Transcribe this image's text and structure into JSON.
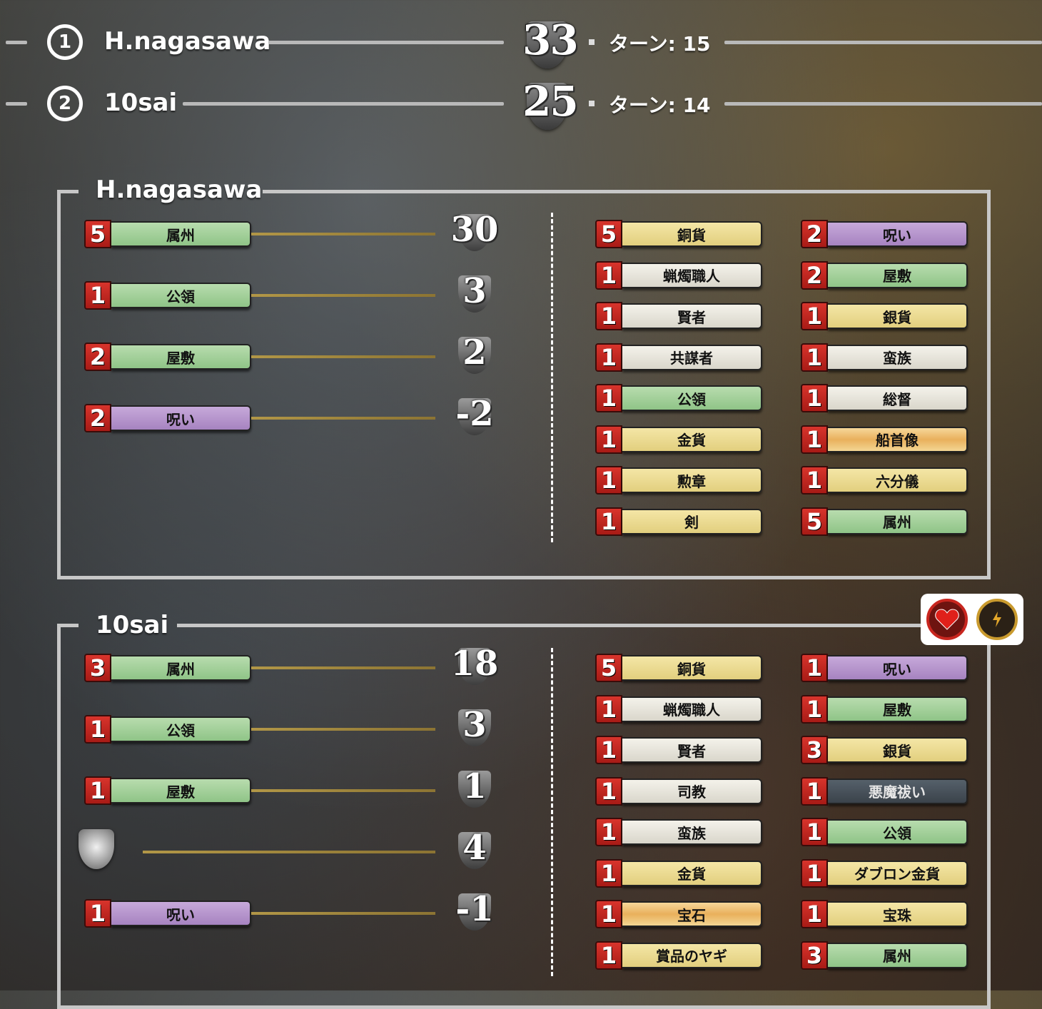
{
  "header": {
    "rows": [
      {
        "rank": "1",
        "name": "H.nagasawa",
        "score": "33",
        "turn": "ターン: 15"
      },
      {
        "rank": "2",
        "name": "10sai",
        "score": "25",
        "turn": "ターン: 14"
      }
    ]
  },
  "players": [
    {
      "title": "H.nagasawa",
      "summary": [
        {
          "count": "5",
          "label": "属州",
          "color": "green",
          "vp": "30"
        },
        {
          "count": "1",
          "label": "公領",
          "color": "green",
          "vp": "3"
        },
        {
          "count": "2",
          "label": "屋敷",
          "color": "green",
          "vp": "2"
        },
        {
          "count": "2",
          "label": "呪い",
          "color": "purple",
          "vp": "-2"
        }
      ],
      "cards_left": [
        {
          "count": "5",
          "label": "銅貨",
          "color": "yellow"
        },
        {
          "count": "1",
          "label": "蝋燭職人",
          "color": "white"
        },
        {
          "count": "1",
          "label": "賢者",
          "color": "white"
        },
        {
          "count": "1",
          "label": "共謀者",
          "color": "white"
        },
        {
          "count": "1",
          "label": "公領",
          "color": "green"
        },
        {
          "count": "1",
          "label": "金貨",
          "color": "yellow"
        },
        {
          "count": "1",
          "label": "勲章",
          "color": "yellow"
        },
        {
          "count": "1",
          "label": "剣",
          "color": "yellow"
        }
      ],
      "cards_right": [
        {
          "count": "2",
          "label": "呪い",
          "color": "purple"
        },
        {
          "count": "2",
          "label": "屋敷",
          "color": "green"
        },
        {
          "count": "1",
          "label": "銀貨",
          "color": "yellow"
        },
        {
          "count": "1",
          "label": "蛮族",
          "color": "white"
        },
        {
          "count": "1",
          "label": "総督",
          "color": "white"
        },
        {
          "count": "1",
          "label": "船首像",
          "color": "orange"
        },
        {
          "count": "1",
          "label": "六分儀",
          "color": "yellow"
        },
        {
          "count": "5",
          "label": "属州",
          "color": "green"
        }
      ]
    },
    {
      "title": "10sai",
      "summary": [
        {
          "count": "3",
          "label": "属州",
          "color": "green",
          "vp": "18"
        },
        {
          "count": "1",
          "label": "公領",
          "color": "green",
          "vp": "3"
        },
        {
          "count": "1",
          "label": "屋敷",
          "color": "green",
          "vp": "1"
        },
        {
          "count": "",
          "label": "",
          "color": "token",
          "vp": "4"
        },
        {
          "count": "1",
          "label": "呪い",
          "color": "purple",
          "vp": "-1"
        }
      ],
      "cards_left": [
        {
          "count": "5",
          "label": "銅貨",
          "color": "yellow"
        },
        {
          "count": "1",
          "label": "蝋燭職人",
          "color": "white"
        },
        {
          "count": "1",
          "label": "賢者",
          "color": "white"
        },
        {
          "count": "1",
          "label": "司教",
          "color": "white"
        },
        {
          "count": "1",
          "label": "蛮族",
          "color": "white"
        },
        {
          "count": "1",
          "label": "金貨",
          "color": "yellow"
        },
        {
          "count": "1",
          "label": "宝石",
          "color": "orange"
        },
        {
          "count": "1",
          "label": "賞品のヤギ",
          "color": "yellow"
        }
      ],
      "cards_right": [
        {
          "count": "1",
          "label": "呪い",
          "color": "purple"
        },
        {
          "count": "1",
          "label": "屋敷",
          "color": "green"
        },
        {
          "count": "3",
          "label": "銀貨",
          "color": "yellow"
        },
        {
          "count": "1",
          "label": "悪魔祓い",
          "color": "dark"
        },
        {
          "count": "1",
          "label": "公領",
          "color": "green"
        },
        {
          "count": "1",
          "label": "ダブロン金貨",
          "color": "yellow"
        },
        {
          "count": "1",
          "label": "宝珠",
          "color": "yellow"
        },
        {
          "count": "3",
          "label": "属州",
          "color": "green"
        }
      ]
    }
  ],
  "icons": {
    "heart": "heart-icon",
    "lightning": "lightning-icon"
  },
  "colors": {
    "counter_red": "#c3261f",
    "panel_border": "#c7c7c7",
    "connector_gold": "#b29747"
  }
}
